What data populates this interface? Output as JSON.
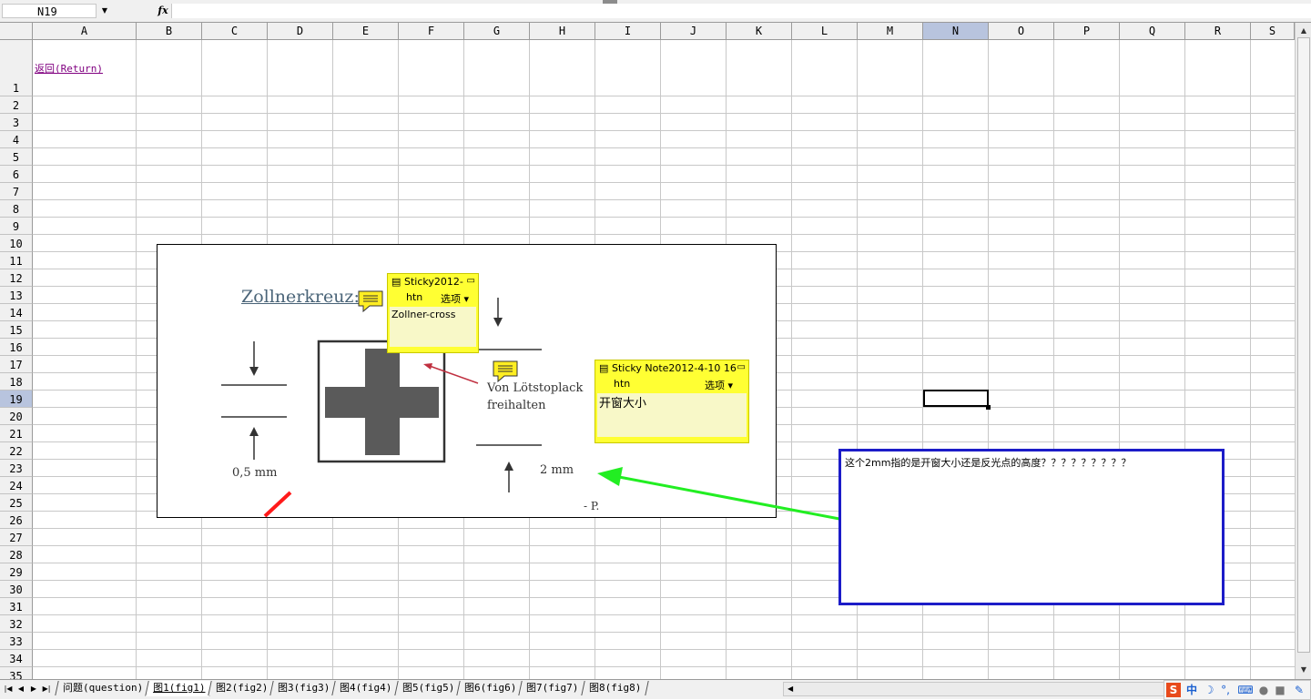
{
  "formula_bar": {
    "name_box": "N19",
    "fx_label": "fx",
    "formula": ""
  },
  "columns": [
    "A",
    "B",
    "C",
    "D",
    "E",
    "F",
    "G",
    "H",
    "I",
    "J",
    "K",
    "L",
    "M",
    "N",
    "O",
    "P",
    "Q",
    "R",
    "S"
  ],
  "selected_column": "N",
  "rows": [
    "1",
    "2",
    "3",
    "4",
    "5",
    "6",
    "7",
    "8",
    "9",
    "10",
    "11",
    "12",
    "13",
    "14",
    "15",
    "16",
    "17",
    "18",
    "19",
    "20",
    "21",
    "22",
    "23",
    "24",
    "25",
    "26",
    "27",
    "28",
    "29",
    "30",
    "31",
    "32",
    "33",
    "34",
    "35"
  ],
  "selected_row": "19",
  "cells": {
    "A1": "返回(Return)"
  },
  "embedded_image": {
    "heading": "Zollnerkreuz:",
    "annotation_line1": "Von Lötstoplack",
    "annotation_line2": "freihalten",
    "dim_left": "0,5 mm",
    "dim_right": "2 mm",
    "fragment": "- P.",
    "sticky_note_1": {
      "title": "Sticky2012-",
      "author": "htn",
      "options": "选项",
      "body": "Zollner-cross"
    },
    "sticky_note_2": {
      "title": "Sticky Note2012-4-10 16",
      "author": "htn",
      "options": "选项",
      "body": "开窗大小"
    }
  },
  "callout": {
    "text": "这个2mm指的是开窗大小还是反光点的高度？？？？？？？？？"
  },
  "sheet_tabs": [
    "问题(question)",
    "图1(fig1)",
    "图2(fig2)",
    "图3(fig3)",
    "图4(fig4)",
    "图5(fig5)",
    "图6(fig6)",
    "图7(fig7)",
    "图8(fig8)"
  ],
  "active_tab_index": 1,
  "ime_bar": {
    "logo": "S",
    "mode": "中"
  },
  "colors": {
    "header_bg": "#f0f0f0",
    "selected_header": "#b8c4de",
    "sticky_yellow": "#ffff33",
    "callout_border": "#1c1cc8",
    "arrow_green": "#22ee22",
    "link_purple": "#800080"
  }
}
